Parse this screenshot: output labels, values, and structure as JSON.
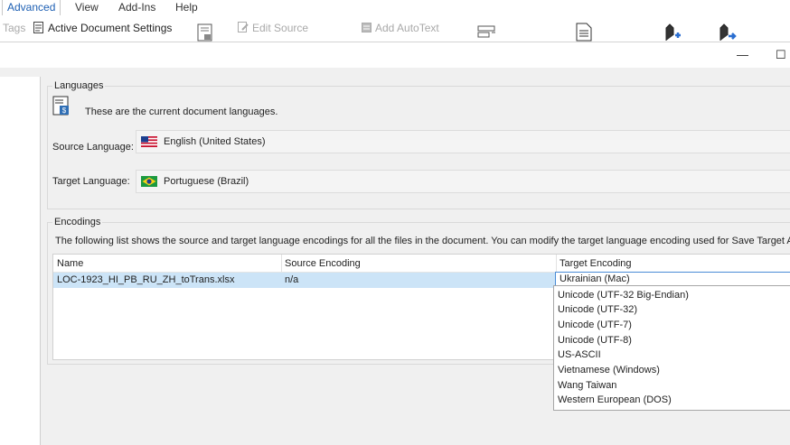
{
  "ribbon": {
    "tabs": [
      {
        "label": "Advanced",
        "active": true
      },
      {
        "label": "View",
        "active": false
      },
      {
        "label": "Add-Ins",
        "active": false
      },
      {
        "label": "Help",
        "active": false
      }
    ],
    "tools": {
      "tags": "Tags",
      "active_doc_settings": "Active Document Settings",
      "edit_source": "Edit Source",
      "add_autotext": "Add AutoText"
    }
  },
  "window": {
    "minimize": "—",
    "maximize": "☐"
  },
  "languages": {
    "title": "Languages",
    "description": "These are the current document languages.",
    "source_label": "Source Language:",
    "source_value": "English (United States)",
    "target_label": "Target Language:",
    "target_value": "Portuguese (Brazil)"
  },
  "encodings": {
    "title": "Encodings",
    "description": "The following list shows the source and target language encodings for all the files in the document. You can modify the target language encoding used for Save Target As.",
    "columns": [
      "Name",
      "Source Encoding",
      "Target Encoding"
    ],
    "rows": [
      {
        "name": "LOC-1923_HI_PB_RU_ZH_toTrans.xlsx",
        "source": "n/a",
        "target": "Ukrainian (Mac)"
      }
    ],
    "options": [
      "Unicode (UTF-32 Big-Endian)",
      "Unicode (UTF-32)",
      "Unicode (UTF-7)",
      "Unicode (UTF-8)",
      "US-ASCII",
      "Vietnamese (Windows)",
      "Wang Taiwan",
      "Western European (DOS)"
    ]
  },
  "colors": {
    "accent": "#1d5fb3",
    "selection": "#cce4f7",
    "focus": "#4a8cd6"
  }
}
